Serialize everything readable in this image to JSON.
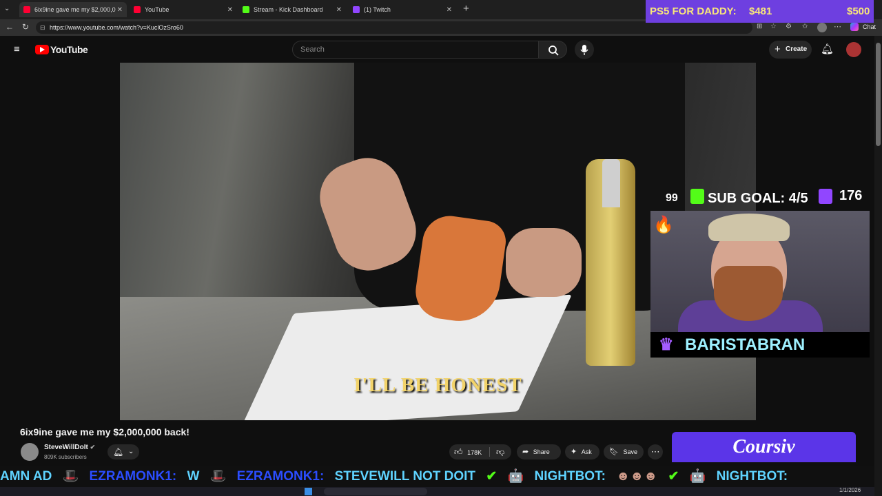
{
  "browser": {
    "tabs": [
      {
        "label": "6ix9ine gave me my $2,000,0",
        "active": true
      },
      {
        "label": "YouTube",
        "active": false
      },
      {
        "label": "Stream - Kick Dashboard",
        "active": false
      },
      {
        "label": "(1) Twitch",
        "active": false
      }
    ],
    "url": "https://www.youtube.com/watch?v=KuclOzSro60",
    "chat_label": "Chat"
  },
  "youtube": {
    "logo_text": "YouTube",
    "search_placeholder": "Search",
    "create_label": "Create"
  },
  "video": {
    "caption": "I'LL BE HONEST",
    "title": "6ix9ine gave me my $2,000,000 back!",
    "channel": "SteveWillDoIt",
    "subscribers": "809K subscribers",
    "likes": "178K",
    "share_label": "Share",
    "ask_label": "Ask",
    "save_label": "Save"
  },
  "overlay": {
    "ps5_label": "PS5 FOR DADDY:",
    "ps5_current": "$481",
    "ps5_goal": "$500",
    "kick_count": "99",
    "sub_goal": "SUB GOAL: 4/5",
    "twitch_count": "176",
    "streamer_name": "BARISTABRAN",
    "ad_text": "Coursiv"
  },
  "ticker": [
    {
      "text": "AMN AD",
      "color": "#5fd3ff"
    },
    {
      "text": "EZRAMONK1:",
      "color": "#2b4dff"
    },
    {
      "text": "W",
      "color": "#5fd3ff"
    },
    {
      "text": "EZRAMONK1:",
      "color": "#2b4dff"
    },
    {
      "text": "STEVEWILL NOT DOIT",
      "color": "#5fd3ff"
    },
    {
      "text": "NIGHTBOT:",
      "color": "#5fd3ff"
    },
    {
      "text": "NIGHTBOT:",
      "color": "#5fd3ff"
    }
  ],
  "taskbar": {
    "date": "1/1/2026"
  }
}
